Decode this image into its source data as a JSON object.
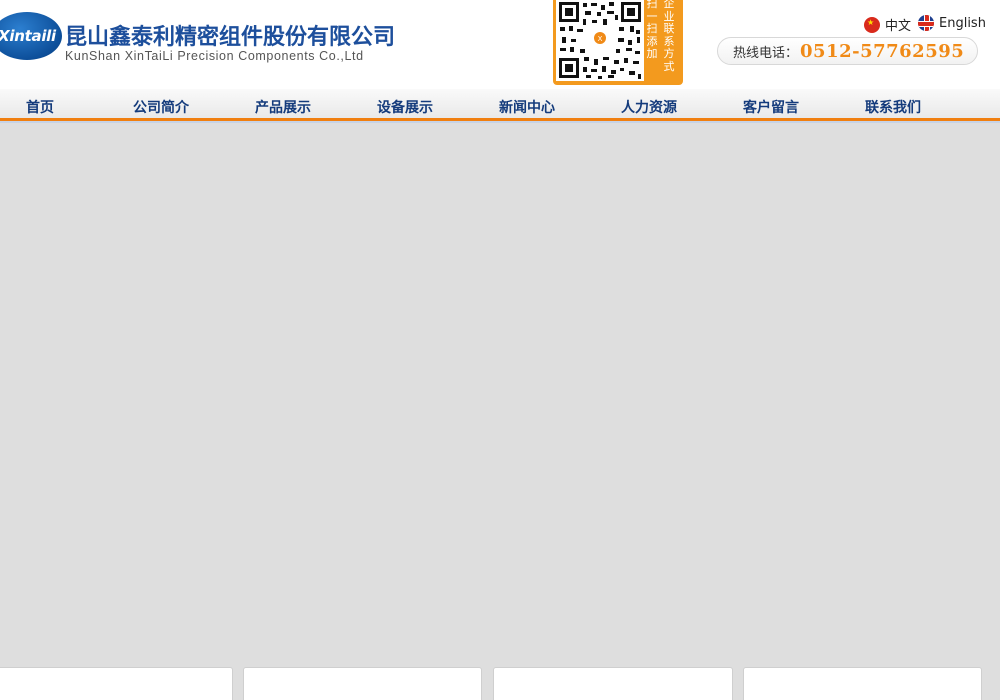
{
  "header": {
    "logo_text": "Xintaili",
    "company_name_cn": "昆山鑫泰利精密组件股份有限公司",
    "company_name_en": "KunShan XinTaiLi Precision Components Co.,Ltd",
    "qr_caption_1": "扫一扫添加",
    "qr_caption_2": "企业联系方式"
  },
  "language": {
    "zh_label": "中文",
    "en_label": "English"
  },
  "hotline": {
    "label": "热线电话：",
    "number": "0512-57762595"
  },
  "nav": {
    "items": [
      {
        "label": "首页"
      },
      {
        "label": "公司简介"
      },
      {
        "label": "产品展示"
      },
      {
        "label": "设备展示"
      },
      {
        "label": "新闻中心"
      },
      {
        "label": "人力资源"
      },
      {
        "label": "客户留言"
      },
      {
        "label": "联系我们"
      }
    ]
  },
  "colors": {
    "brand_blue": "#1d4f9c",
    "accent_orange": "#f08a17",
    "body_background": "#dedede"
  }
}
